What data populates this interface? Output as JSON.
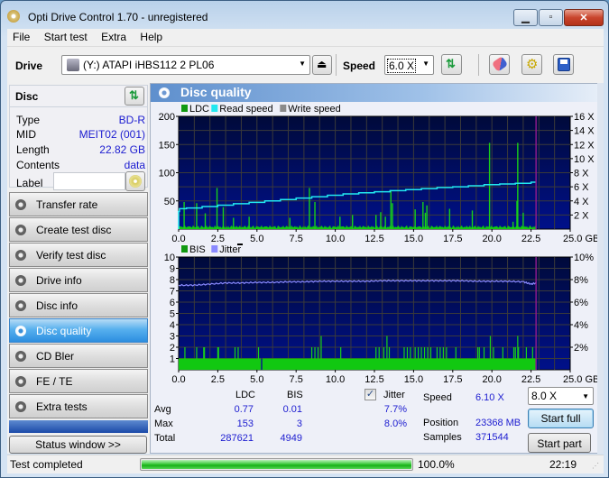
{
  "window": {
    "title": "Opti Drive Control 1.70 - unregistered",
    "controls": {
      "minimize": "▁",
      "maximize": "▫",
      "close": "✕"
    }
  },
  "menu": [
    "File",
    "Start test",
    "Extra",
    "Help"
  ],
  "toolbar": {
    "drive_label": "Drive",
    "drive_value": "(Y:)   ATAPI iHBS112   2 PL06",
    "speed_label": "Speed",
    "speed_value": "6.0 X",
    "icons": [
      "drive-icon",
      "eject-icon",
      "refresh-icon",
      "erase-icon",
      "settings-icon",
      "save-icon"
    ]
  },
  "disc": {
    "header": "Disc",
    "fields": [
      {
        "key": "Type",
        "value": "BD-R"
      },
      {
        "key": "MID",
        "value": "MEIT02 (001)"
      },
      {
        "key": "Length",
        "value": "22.82 GB"
      },
      {
        "key": "Contents",
        "value": "data"
      }
    ],
    "label_key": "Label",
    "label_value": ""
  },
  "nav": [
    {
      "label": "Transfer rate",
      "active": false
    },
    {
      "label": "Create test disc",
      "active": false
    },
    {
      "label": "Verify test disc",
      "active": false
    },
    {
      "label": "Drive info",
      "active": false
    },
    {
      "label": "Disc info",
      "active": false
    },
    {
      "label": "Disc quality",
      "active": true
    },
    {
      "label": "CD Bler",
      "active": false
    },
    {
      "label": "FE / TE",
      "active": false
    },
    {
      "label": "Extra tests",
      "active": false
    }
  ],
  "status_window_button": "Status window >>",
  "panel_title": "Disc quality",
  "chart_data": [
    {
      "type": "bar",
      "title": "LDC / Read speed",
      "legend": [
        {
          "name": "LDC",
          "color": "#119911"
        },
        {
          "name": "Read speed",
          "color": "#22e8f0"
        },
        {
          "name": "Write speed",
          "color": "#8a8a8a"
        }
      ],
      "x_ticks": [
        "0.0",
        "2.5",
        "5.0",
        "7.5",
        "10.0",
        "12.5",
        "15.0",
        "17.5",
        "20.0",
        "22.5",
        "25.0 GB"
      ],
      "xlim": [
        0,
        25
      ],
      "y_ticks_left": [
        "200",
        "150",
        "100",
        "50"
      ],
      "ylim_left": [
        0,
        200
      ],
      "y_ticks_right": [
        "16 X",
        "14 X",
        "12 X",
        "10 X",
        "8 X",
        "6 X",
        "4 X",
        "2 X"
      ],
      "ylim_right": [
        0,
        16
      ],
      "data_end": 22.82,
      "ldc_spikes": [
        {
          "x": 0.35,
          "y": 48
        },
        {
          "x": 1.15,
          "y": 46
        },
        {
          "x": 1.7,
          "y": 28
        },
        {
          "x": 2.45,
          "y": 73
        },
        {
          "x": 2.85,
          "y": 39
        },
        {
          "x": 3.5,
          "y": 20
        },
        {
          "x": 4.5,
          "y": 22
        },
        {
          "x": 7.1,
          "y": 20
        },
        {
          "x": 8.35,
          "y": 73
        },
        {
          "x": 8.7,
          "y": 48
        },
        {
          "x": 10.3,
          "y": 22
        },
        {
          "x": 11.1,
          "y": 25
        },
        {
          "x": 12.6,
          "y": 25
        },
        {
          "x": 12.9,
          "y": 30
        },
        {
          "x": 13.2,
          "y": 22
        },
        {
          "x": 13.55,
          "y": 69
        },
        {
          "x": 13.65,
          "y": 46
        },
        {
          "x": 15.1,
          "y": 35
        },
        {
          "x": 15.6,
          "y": 48
        },
        {
          "x": 15.75,
          "y": 29
        },
        {
          "x": 15.85,
          "y": 42
        },
        {
          "x": 17.3,
          "y": 36
        },
        {
          "x": 18.75,
          "y": 33
        },
        {
          "x": 19.85,
          "y": 153
        },
        {
          "x": 21.35,
          "y": 13
        },
        {
          "x": 21.6,
          "y": 50
        },
        {
          "x": 21.65,
          "y": 153
        },
        {
          "x": 22.0,
          "y": 29
        }
      ],
      "read_speed": [
        [
          0.0,
          2.5
        ],
        [
          0.05,
          2.9
        ],
        [
          0.5,
          3.0
        ],
        [
          1.5,
          3.2
        ],
        [
          2.5,
          3.4
        ],
        [
          3.5,
          3.6
        ],
        [
          4.5,
          3.8
        ],
        [
          5.5,
          4.0
        ],
        [
          6.5,
          4.2
        ],
        [
          7.5,
          4.4
        ],
        [
          8.5,
          4.6
        ],
        [
          9.5,
          4.8
        ],
        [
          10.5,
          5.0
        ],
        [
          11.5,
          5.15
        ],
        [
          12.5,
          5.3
        ],
        [
          13.5,
          5.45
        ],
        [
          14.5,
          5.6
        ],
        [
          15.5,
          5.75
        ],
        [
          16.5,
          5.9
        ],
        [
          17.5,
          6.0
        ],
        [
          18.5,
          6.15
        ],
        [
          19.5,
          6.3
        ],
        [
          20.5,
          6.4
        ],
        [
          21.5,
          6.5
        ],
        [
          22.5,
          6.65
        ],
        [
          22.82,
          6.65
        ]
      ]
    },
    {
      "type": "bar",
      "title": "BIS / Jitter",
      "legend": [
        {
          "name": "BIS",
          "color": "#119911"
        },
        {
          "name": "Jitter",
          "color": "#8a8aff"
        }
      ],
      "x_ticks": [
        "0.0",
        "2.5",
        "5.0",
        "7.5",
        "10.0",
        "12.5",
        "15.0",
        "17.5",
        "20.0",
        "22.5",
        "25.0 GB"
      ],
      "xlim": [
        0,
        25
      ],
      "y_ticks_left": [
        "10",
        "9",
        "8",
        "7",
        "6",
        "5",
        "4",
        "3",
        "2",
        "1"
      ],
      "ylim_left": [
        0,
        10
      ],
      "y_ticks_right": [
        "10%",
        "8%",
        "6%",
        "4%",
        "2%"
      ],
      "ylim_right": [
        0,
        10
      ],
      "data_end": 22.82,
      "bis_baseline": 1,
      "bis_gap_at": 5.3,
      "bis_spikes": [
        {
          "x": 0.4,
          "y": 2
        },
        {
          "x": 1.15,
          "y": 2
        },
        {
          "x": 1.6,
          "y": 2
        },
        {
          "x": 1.65,
          "y": 2
        },
        {
          "x": 2.5,
          "y": 2
        },
        {
          "x": 2.55,
          "y": 2
        },
        {
          "x": 3.6,
          "y": 2
        },
        {
          "x": 3.8,
          "y": 2
        },
        {
          "x": 5.1,
          "y": 2
        },
        {
          "x": 8.5,
          "y": 2
        },
        {
          "x": 8.7,
          "y": 2
        },
        {
          "x": 8.9,
          "y": 2
        },
        {
          "x": 9.1,
          "y": 3
        },
        {
          "x": 10.35,
          "y": 2
        },
        {
          "x": 12.6,
          "y": 2
        },
        {
          "x": 12.8,
          "y": 2
        },
        {
          "x": 13.1,
          "y": 2
        },
        {
          "x": 13.3,
          "y": 3
        },
        {
          "x": 13.45,
          "y": 2
        },
        {
          "x": 14.4,
          "y": 2
        },
        {
          "x": 14.6,
          "y": 2
        },
        {
          "x": 14.8,
          "y": 2
        },
        {
          "x": 15.1,
          "y": 2
        },
        {
          "x": 15.3,
          "y": 2
        },
        {
          "x": 15.5,
          "y": 2
        },
        {
          "x": 15.7,
          "y": 2
        },
        {
          "x": 15.9,
          "y": 2
        },
        {
          "x": 16.1,
          "y": 2
        },
        {
          "x": 16.5,
          "y": 2
        },
        {
          "x": 16.7,
          "y": 2
        },
        {
          "x": 16.9,
          "y": 2
        },
        {
          "x": 17.1,
          "y": 2
        },
        {
          "x": 17.7,
          "y": 2
        },
        {
          "x": 19.1,
          "y": 2
        },
        {
          "x": 19.2,
          "y": 2
        },
        {
          "x": 19.5,
          "y": 2
        },
        {
          "x": 19.9,
          "y": 3
        },
        {
          "x": 20.1,
          "y": 2
        },
        {
          "x": 20.7,
          "y": 2
        },
        {
          "x": 21.4,
          "y": 2
        },
        {
          "x": 21.5,
          "y": 2
        },
        {
          "x": 21.65,
          "y": 3
        },
        {
          "x": 21.7,
          "y": 2
        },
        {
          "x": 22.2,
          "y": 2
        },
        {
          "x": 22.6,
          "y": 2
        }
      ],
      "jitter": [
        [
          0.0,
          7.5
        ],
        [
          1.0,
          7.5
        ],
        [
          2.0,
          7.6
        ],
        [
          3.0,
          7.7
        ],
        [
          4.0,
          7.7
        ],
        [
          5.0,
          7.75
        ],
        [
          6.0,
          7.75
        ],
        [
          7.0,
          7.8
        ],
        [
          8.0,
          7.8
        ],
        [
          9.0,
          7.85
        ],
        [
          10.0,
          7.85
        ],
        [
          11.0,
          7.85
        ],
        [
          12.0,
          7.85
        ],
        [
          13.0,
          7.9
        ],
        [
          14.0,
          7.9
        ],
        [
          15.0,
          7.9
        ],
        [
          16.0,
          7.9
        ],
        [
          17.0,
          7.9
        ],
        [
          18.0,
          7.9
        ],
        [
          19.0,
          7.85
        ],
        [
          20.0,
          7.85
        ],
        [
          21.0,
          7.85
        ],
        [
          22.0,
          7.8
        ],
        [
          22.5,
          7.6
        ],
        [
          22.82,
          7.7
        ]
      ]
    }
  ],
  "stats": {
    "col_ldc": "LDC",
    "col_bis": "BIS",
    "jitter_label": "Jitter",
    "jitter_checked": true,
    "rows": [
      {
        "label": "Avg",
        "ldc": "0.77",
        "bis": "0.01",
        "jitter": "7.7%"
      },
      {
        "label": "Max",
        "ldc": "153",
        "bis": "3",
        "jitter": "8.0%"
      },
      {
        "label": "Total",
        "ldc": "287621",
        "bis": "4949",
        "jitter": ""
      }
    ],
    "speed_label": "Speed",
    "speed_value": "6.10 X",
    "position_label": "Position",
    "position_value": "23368 MB",
    "samples_label": "Samples",
    "samples_value": "371544",
    "test_speed": "8.0 X",
    "start_full": "Start full",
    "start_part": "Start part"
  },
  "statusbar": {
    "text": "Test completed",
    "progress_percent": 100,
    "progress_text": "100.0%",
    "time": "22:19"
  }
}
